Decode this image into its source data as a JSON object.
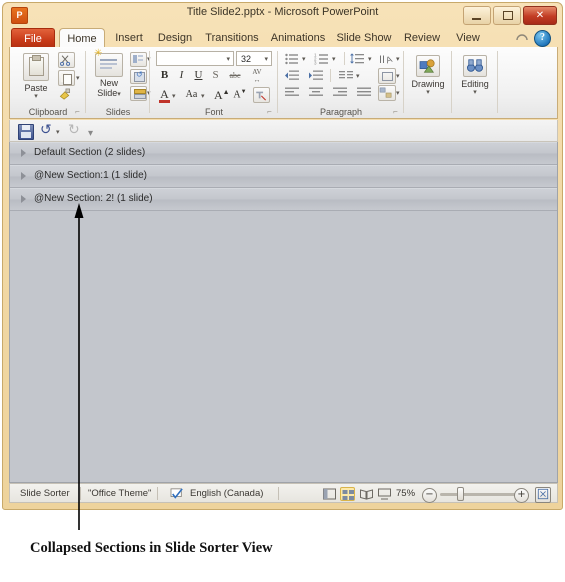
{
  "window": {
    "app_icon_letter": "P",
    "title": "Title Slide2.pptx  -  Microsoft PowerPoint",
    "controls": {
      "minimize": "minimize-button",
      "restore": "restore-button",
      "close_label": "✕"
    }
  },
  "tabs": [
    {
      "label": "File",
      "active": false,
      "kind": "file"
    },
    {
      "label": "Home",
      "active": true
    },
    {
      "label": "Insert",
      "active": false
    },
    {
      "label": "Design",
      "active": false
    },
    {
      "label": "Transitions",
      "active": false
    },
    {
      "label": "Animations",
      "active": false
    },
    {
      "label": "Slide Show",
      "active": false
    },
    {
      "label": "Review",
      "active": false
    },
    {
      "label": "View",
      "active": false
    }
  ],
  "help": {
    "collapse_ribbon_icon": "collapse-ribbon-icon",
    "help_label": "?"
  },
  "ribbon": {
    "groups": [
      {
        "name": "Clipboard",
        "label": "Clipboard"
      },
      {
        "name": "Slides",
        "label": "Slides"
      },
      {
        "name": "Font",
        "label": "Font"
      },
      {
        "name": "Paragraph",
        "label": "Paragraph"
      },
      {
        "name": "Drawing",
        "label": "Drawing"
      },
      {
        "name": "Editing",
        "label": "Editing"
      }
    ],
    "clipboard": {
      "paste_label": "Paste",
      "cut_icon": "scissors-icon",
      "copy_icon": "copy-icon",
      "format_painter_icon": "format-painter-icon"
    },
    "slides": {
      "new_slide_label_line1": "New",
      "new_slide_label_line2": "Slide",
      "layout_icon": "layout-icon",
      "reset_icon": "reset-icon",
      "section_icon": "section-icon"
    },
    "font": {
      "font_name_value": "",
      "font_size_value": "32",
      "bold": "B",
      "italic": "I",
      "underline": "U",
      "shadow": "S",
      "strikethrough": "abc",
      "char_spacing": "AV",
      "font_color": "A",
      "change_case": "Aa",
      "grow_font": "A",
      "shrink_font": "A",
      "clear_formatting_icon": "clear-formatting-icon"
    },
    "paragraph": {
      "bullets_icon": "bullets-icon",
      "numbering_icon": "numbering-icon",
      "line_spacing_icon": "line-spacing-icon",
      "text_direction_icon": "text-direction-icon",
      "decrease_indent_icon": "decrease-indent-icon",
      "increase_indent_icon": "increase-indent-icon",
      "columns_icon": "columns-icon",
      "align_text_icon": "align-text-icon",
      "align_left_icon": "align-left-icon",
      "align_center_icon": "align-center-icon",
      "align_right_icon": "align-right-icon",
      "justify_icon": "justify-icon",
      "smartart_icon": "convert-to-smartart-icon"
    },
    "drawing": {
      "label": "Drawing",
      "icon": "shapes-icon"
    },
    "editing": {
      "label": "Editing",
      "icon": "binoculars-icon"
    }
  },
  "quick_access": {
    "save_icon": "save-icon",
    "undo_icon": "undo-icon",
    "redo_icon": "redo-icon",
    "customize_icon": "customize-toolbar-icon"
  },
  "slide_sorter": {
    "sections": [
      {
        "label": "Default Section (2 slides)",
        "name": "Default Section",
        "slide_count": "2 slides",
        "collapsed": true
      },
      {
        "label": "@New Section:1 (1 slide)",
        "name": "@New Section:1",
        "slide_count": "1 slide",
        "collapsed": true
      },
      {
        "label": "@New Section: 2! (1 slide)",
        "name": "@New Section: 2!",
        "slide_count": "1 slide",
        "collapsed": true
      }
    ]
  },
  "status_bar": {
    "view_name": "Slide Sorter",
    "theme": "\"Office Theme\"",
    "spell_check_icon": "spell-check-icon",
    "language": "English (Canada)",
    "views": [
      {
        "name": "normal-view",
        "active": false
      },
      {
        "name": "slide-sorter-view",
        "active": true
      },
      {
        "name": "reading-view",
        "active": false
      },
      {
        "name": "slide-show-view",
        "active": false
      }
    ],
    "zoom_level": "75%",
    "zoom_out_label": "−",
    "zoom_in_label": "+",
    "fit_to_window_label": "⬚"
  },
  "annotation": {
    "caption": "Collapsed Sections in Slide Sorter View",
    "arrow_name": "callout-arrow"
  },
  "colors": {
    "window_chrome": "#f2d9a6",
    "file_tab_red": "#c83a18",
    "workarea_gray": "#c3c6cc",
    "section_row": "#c4c7cd",
    "highlight_yellow": "#fde9a8"
  }
}
